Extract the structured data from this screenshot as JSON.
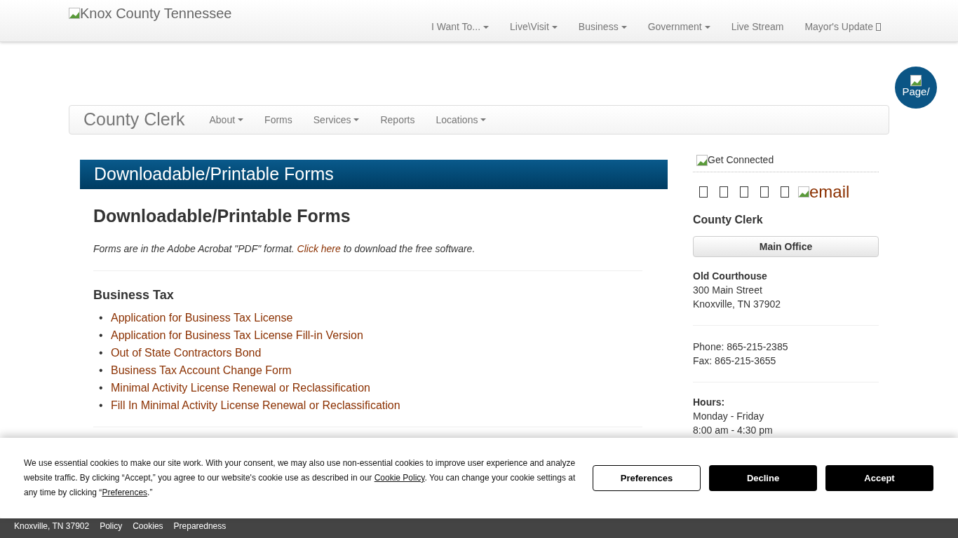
{
  "top_nav": {
    "logo_alt": "Knox County Tennessee",
    "items": [
      {
        "label": "I Want To...",
        "kind": "dropdown"
      },
      {
        "label": "Live\\Visit",
        "kind": "dropdown"
      },
      {
        "label": "Business",
        "kind": "dropdown"
      },
      {
        "label": "Government",
        "kind": "dropdown"
      },
      {
        "label": "Live Stream",
        "kind": "link"
      },
      {
        "label": "Mayor's Update",
        "kind": "external"
      }
    ]
  },
  "floating_button": {
    "alt": "Page/"
  },
  "sub_nav": {
    "title": "County Clerk",
    "items": [
      {
        "label": "About",
        "kind": "dropdown"
      },
      {
        "label": "Forms",
        "kind": "link"
      },
      {
        "label": "Services",
        "kind": "dropdown"
      },
      {
        "label": "Reports",
        "kind": "link"
      },
      {
        "label": "Locations",
        "kind": "dropdown"
      }
    ]
  },
  "page_banner": {
    "title": "Downloadable/Printable Forms"
  },
  "content": {
    "heading": "Downloadable/Printable Forms",
    "intro": {
      "before": "Forms are in the Adobe Acrobat \"PDF\" format.",
      "link": "Click here",
      "after": "to download the free software."
    },
    "sections": [
      {
        "heading": "Business Tax",
        "bullet": "•",
        "links": [
          "Application for Business Tax License",
          "Application for Business Tax License Fill-in Version",
          "Out of State Contractors Bond",
          "Business Tax Account Change Form",
          "Minimal Activity License Renewal or Reclassification",
          "Fill In Minimal Activity License Renewal or Reclassification"
        ]
      }
    ]
  },
  "sidebar": {
    "get_connected_alt": "Get Connected",
    "social_links": [
      {
        "kind": "glyph"
      },
      {
        "kind": "glyph"
      },
      {
        "kind": "glyph"
      },
      {
        "kind": "glyph"
      },
      {
        "kind": "glyph"
      },
      {
        "kind": "image",
        "alt": "email"
      }
    ],
    "title": "County Clerk",
    "button": "Main Office",
    "address": {
      "name": "Old Courthouse",
      "lines": [
        "300 Main Street",
        "Knoxville, TN 37902"
      ]
    },
    "contact": [
      "Phone: 865-215-2385",
      "Fax: 865-215-3655"
    ],
    "hours": {
      "label": "Hours:",
      "lines": [
        "Monday - Friday",
        "8:00 am - 4:30 pm"
      ]
    }
  },
  "cookie_banner": {
    "text_1": "We use essential cookies to make our site work. With your consent, we may also use non-essential cookies to improve user experience and analyze website traffic. By clicking “Accept,” you agree to our website's cookie use as described in our",
    "link_1": "Cookie Policy",
    "text_2": ". You can change your cookie settings at any time by clicking “",
    "link_2": "Preferences",
    "text_3": ".”",
    "buttons": [
      {
        "label": "Preferences",
        "kind": "outline"
      },
      {
        "label": "Decline",
        "kind": "solid"
      },
      {
        "label": "Accept",
        "kind": "solid"
      }
    ]
  },
  "footer": {
    "items": [
      "Knoxville, TN 37902",
      "Policy",
      "Cookies",
      "Preparedness"
    ]
  }
}
